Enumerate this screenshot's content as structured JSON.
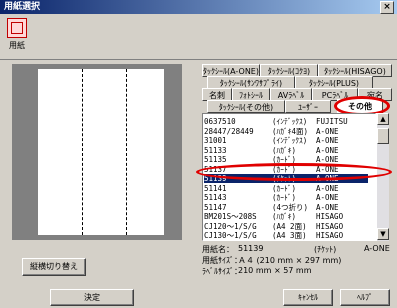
{
  "window": {
    "title": "用紙選択",
    "close_glyph": "×"
  },
  "toolbar": {
    "paper_label": "用紙"
  },
  "tabs": {
    "row1": [
      "ﾀｯｸｼｰﾙ(A-ONE)",
      "ﾀｯｸｼｰﾙ(ｺｸﾖ)",
      "ﾀｯｸｼｰﾙ(HISAGO)"
    ],
    "row2": [
      "ﾀｯｸｼｰﾙ(ｻﾝﾜｻﾌﾟﾗｲ)",
      "ﾀｯｸｼｰﾙ(PLUS)"
    ],
    "row3": [
      "名刺",
      "ﾌｫﾄｼｰﾙ",
      "AVﾗﾍﾞﾙ",
      "PCﾗﾍﾞﾙ",
      "宛名"
    ],
    "row4": [
      "ﾀｯｸｼｰﾙ(その他)",
      "ﾕｰｻﾞｰ",
      "その他"
    ],
    "active": "その他"
  },
  "paper_list": {
    "rows": [
      {
        "code": "0637510",
        "name": "(ｲﾝﾃﾞｯｸｽ)",
        "maker": "FUJITSU"
      },
      {
        "code": "28447/28449",
        "name": "(ﾊｶﾞｷ4面)",
        "maker": "A-ONE"
      },
      {
        "code": "31001",
        "name": "(ｲﾝﾃﾞｯｸｽ)",
        "maker": "A-ONE"
      },
      {
        "code": "51133",
        "name": "(ﾊｶﾞｷ)",
        "maker": "A-ONE"
      },
      {
        "code": "51135",
        "name": "(ｶｰﾄﾞ)",
        "maker": "A-ONE"
      },
      {
        "code": "51137",
        "name": "(ｶｰﾄﾞ)",
        "maker": "A-ONE"
      },
      {
        "code": "51139",
        "name": "(ﾁｹｯﾄ)",
        "maker": "A-ONE"
      },
      {
        "code": "51141",
        "name": "(ｶｰﾄﾞ)",
        "maker": "A-ONE"
      },
      {
        "code": "51143",
        "name": "(ｶｰﾄﾞ)",
        "maker": "A-ONE"
      },
      {
        "code": "51147",
        "name": "(4つ折り)",
        "maker": "A-ONE"
      },
      {
        "code": "BM201S～208S",
        "name": "(ﾊｶﾞｷ)",
        "maker": "HISAGO"
      },
      {
        "code": "CJ120～1/S/G",
        "name": "(A4 2面)",
        "maker": "HISAGO"
      },
      {
        "code": "CJ130～1/S/G",
        "name": "(A4 3面)",
        "maker": "HISAGO"
      },
      {
        "code": "CJ140S～141S",
        "name": "(ﾊｶﾞｷ)",
        "maker": "HISAGO"
      },
      {
        "code": "CJ142～3/S/G",
        "name": "(A4 4面)",
        "maker": "HISAGO"
      }
    ],
    "selected_index": 6
  },
  "info": {
    "name_label": "用紙名：",
    "name_value": "51139",
    "name_type": "(ﾁｹｯﾄ)",
    "name_maker": "A-ONE",
    "size_label": "用紙ｻｲｽﾞ：",
    "size_value": "Ａ４ (210 mm × 297 mm)",
    "label_size_label": "ﾗﾍﾞﾙｻｲｽﾞ：",
    "label_size_value": "210 mm × 57 mm"
  },
  "buttons": {
    "orientation": "縦横切り替え",
    "ok": "決定",
    "cancel": "ｷｬﾝｾﾙ",
    "help": "ﾍﾙﾌﾟ"
  },
  "colors": {
    "selection": "#0a246a",
    "annotation": "#e00000"
  }
}
